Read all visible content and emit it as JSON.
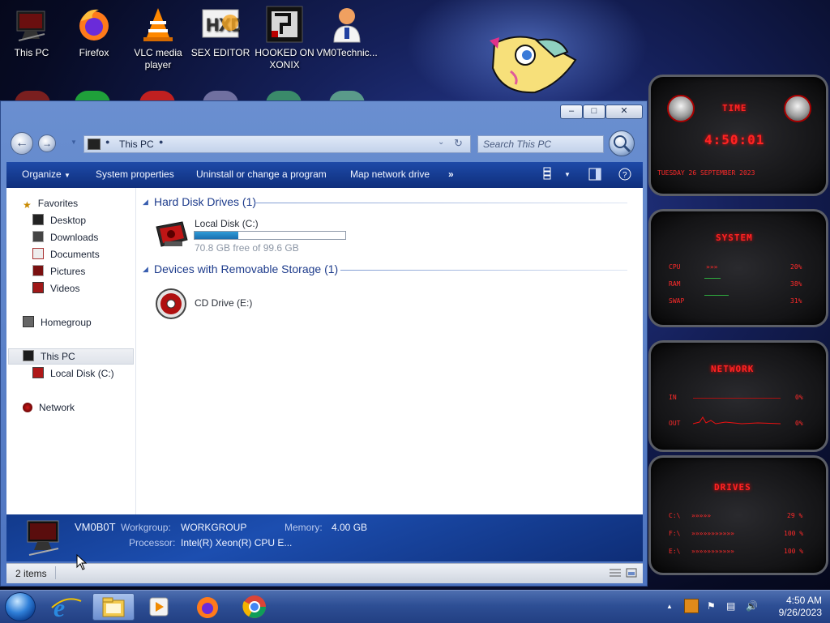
{
  "desktop": {
    "icons": [
      {
        "label": "This PC"
      },
      {
        "label": "Firefox"
      },
      {
        "label": "VLC media player"
      },
      {
        "label": "SEX EDITOR"
      },
      {
        "label": "HOOKED ON XONIX"
      },
      {
        "label": "VM0Technic..."
      }
    ]
  },
  "explorer": {
    "title_buttons": {
      "minimize": "‒",
      "maximize": "□",
      "close": "✕"
    },
    "address": {
      "path": "This PC"
    },
    "search": {
      "placeholder": "Search This PC"
    },
    "commands": {
      "organize": "Organize",
      "system_properties": "System properties",
      "uninstall": "Uninstall or change a program",
      "map_network": "Map network drive",
      "more": "»"
    },
    "nav": {
      "favorites": "Favorites",
      "desktop": "Desktop",
      "downloads": "Downloads",
      "documents": "Documents",
      "pictures": "Pictures",
      "videos": "Videos",
      "homegroup": "Homegroup",
      "this_pc": "This PC",
      "local_disk": "Local Disk (C:)",
      "network": "Network"
    },
    "groups": {
      "hard_disk": {
        "title": "Hard Disk Drives (1)"
      },
      "removable": {
        "title": "Devices with Removable Storage (1)"
      }
    },
    "drives": {
      "local_disk": {
        "label": "Local Disk (C:)",
        "free_text": "70.8 GB free of 99.6 GB",
        "used_fraction": 0.289
      },
      "cd_drive": {
        "label": "CD Drive (E:)"
      }
    },
    "details": {
      "computer_name": "VM0B0T",
      "workgroup_label": "Workgroup:",
      "workgroup_value": "WORKGROUP",
      "memory_label": "Memory:",
      "memory_value": "4.00 GB",
      "processor_label": "Processor:",
      "processor_value": "Intel(R) Xeon(R) CPU E..."
    },
    "status": {
      "items": "2 items"
    }
  },
  "gadgets": {
    "time": {
      "title": "TIME",
      "clock": "4:50:01",
      "date": "TUESDAY 26 SEPTEMBER 2023"
    },
    "system": {
      "title": "SYSTEM",
      "cpu_label": "CPU",
      "cpu_value": "20%",
      "ram_label": "RAM",
      "ram_value": "38%",
      "swap_label": "SWAP",
      "swap_value": "31%"
    },
    "network": {
      "title": "NETWORK",
      "in_label": "IN",
      "in_value": "0%",
      "out_label": "OUT",
      "out_value": "0%"
    },
    "drives": {
      "title": "DRIVES",
      "c_label": "C:\\",
      "c_value": "29 %",
      "e_label": "E:\\",
      "e_value": "100 %",
      "f_label": "F:\\",
      "f_value": "100 %"
    }
  },
  "taskbar": {
    "clock_time": "4:50 AM",
    "clock_date": "9/26/2023"
  },
  "colors": {
    "accent_blue": "#1e4aa8",
    "gadget_red": "#ff2323",
    "progress_fill": "#2f9cd7"
  }
}
